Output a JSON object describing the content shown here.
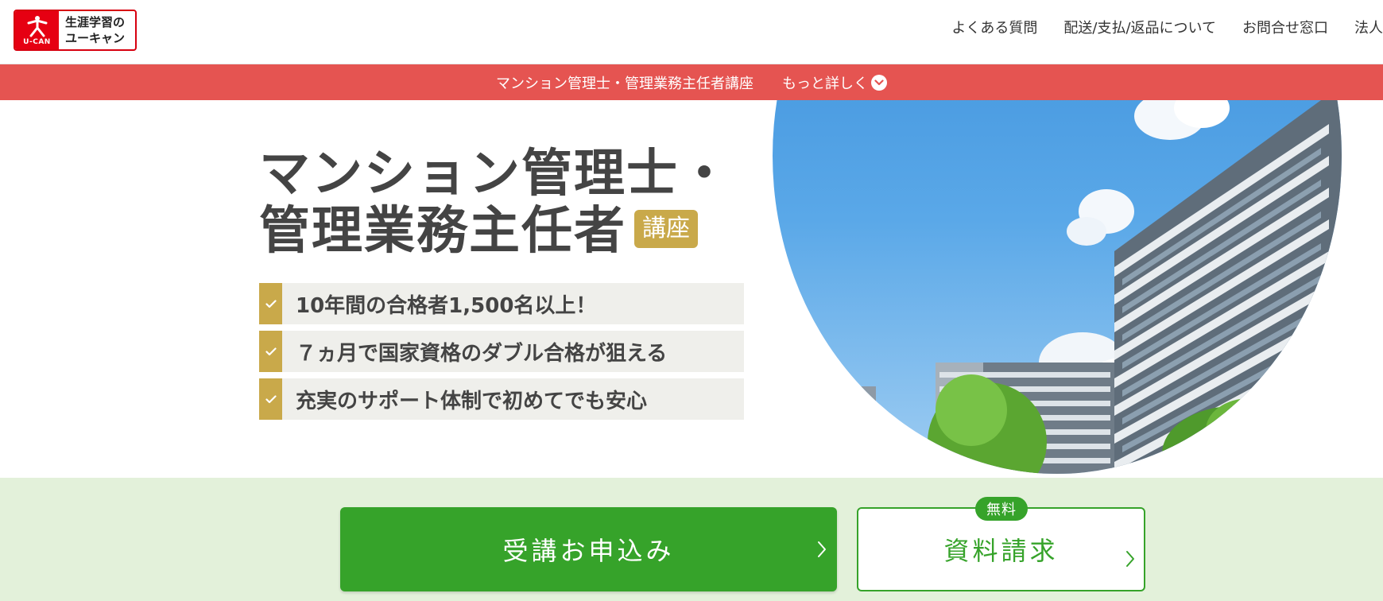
{
  "header": {
    "logo": {
      "mark_text": "U-CAN",
      "line1": "生涯学習の",
      "line2": "ユーキャン"
    },
    "nav": [
      {
        "label": "よくある質問"
      },
      {
        "label": "配送/支払/返品について"
      },
      {
        "label": "お問合せ窓口"
      },
      {
        "label": "法人"
      }
    ]
  },
  "subbar": {
    "title": "マンション管理士・管理業務主任者講座",
    "more_label": "もっと詳しく",
    "icon": "chevron-down-icon"
  },
  "hero": {
    "title_line1": "マンション管理士・",
    "title_line2": "管理業務主任者",
    "badge": "講座",
    "features": [
      {
        "text": "10年間の合格者1,500名以上！"
      },
      {
        "text": "７ヵ月で国家資格のダブル合格が狙える"
      },
      {
        "text": "充実のサポート体制で初めてでも安心"
      }
    ],
    "image": "apartment-buildings-photo"
  },
  "cta": {
    "apply_label": "受講お申込み",
    "doc_label": "資料請求",
    "free_badge": "無料"
  },
  "colors": {
    "brand_red": "#e60012",
    "banner_red": "#e55451",
    "gold": "#c9a94a",
    "green": "#36a32a",
    "cta_bg": "#e3f1da"
  }
}
